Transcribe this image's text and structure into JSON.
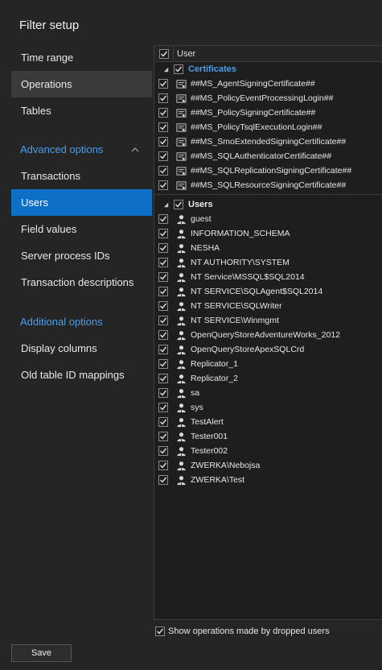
{
  "window": {
    "title": "Filter setup"
  },
  "sidebar": {
    "items_top": [
      "Time range",
      "Operations",
      "Tables"
    ],
    "advanced_label": "Advanced options",
    "advanced_items": [
      "Transactions",
      "Users",
      "Field values",
      "Server process IDs",
      "Transaction descriptions"
    ],
    "additional_label": "Additional options",
    "additional_items": [
      "Display columns",
      "Old table ID mappings"
    ]
  },
  "grid": {
    "column_header": "User",
    "groups": [
      {
        "name": "Certificates",
        "items": [
          "##MS_AgentSigningCertificate##",
          "##MS_PolicyEventProcessingLogin##",
          "##MS_PolicySigningCertificate##",
          "##MS_PolicyTsqlExecutionLogin##",
          "##MS_SmoExtendedSigningCertificate##",
          "##MS_SQLAuthenticatorCertificate##",
          "##MS_SQLReplicationSigningCertificate##",
          "##MS_SQLResourceSigningCertificate##"
        ]
      },
      {
        "name": "Users",
        "items": [
          "guest",
          "INFORMATION_SCHEMA",
          "NESHA",
          "NT AUTHORITY\\SYSTEM",
          "NT Service\\MSSQL$SQL2014",
          "NT SERVICE\\SQLAgent$SQL2014",
          "NT SERVICE\\SQLWriter",
          "NT SERVICE\\Winmgmt",
          "OpenQueryStoreAdventureWorks_2012",
          "OpenQueryStoreApexSQLCrd",
          "Replicator_1",
          "Replicator_2",
          "sa",
          "sys",
          "TestAlert",
          "Tester001",
          "Tester002",
          "ZWERKA\\Nebojsa",
          "ZWERKA\\Test"
        ]
      }
    ]
  },
  "footer": {
    "dropped_users_label": "Show operations made by dropped users",
    "save_label": "Save"
  },
  "colors": {
    "accent": "#0e6fc7",
    "link": "#4a9de8",
    "background": "#252526"
  }
}
